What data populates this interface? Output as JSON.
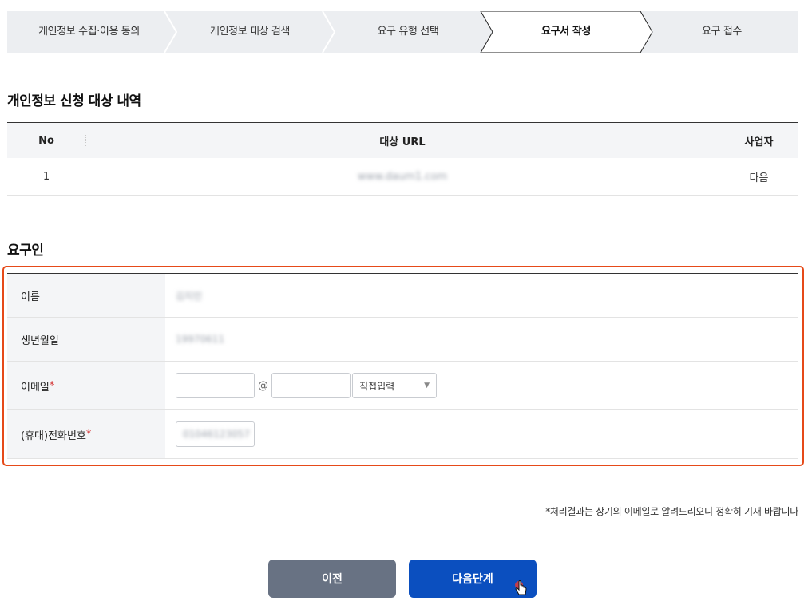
{
  "stepper": {
    "steps": [
      {
        "label": "개인정보 수집·이용 동의"
      },
      {
        "label": "개인정보 대상 검색"
      },
      {
        "label": "요구 유형 선택"
      },
      {
        "label": "요구서 작성"
      },
      {
        "label": "요구 접수"
      }
    ],
    "active_index": 3
  },
  "target_section": {
    "title": "개인정보 신청 대상 내역",
    "columns": [
      "No",
      "대상 URL",
      "사업자"
    ],
    "rows": [
      {
        "no": "1",
        "url": "www.daum1.com",
        "business": "다음"
      }
    ]
  },
  "requester_section": {
    "title": "요구인",
    "name": {
      "label": "이름",
      "value": "김지민"
    },
    "birth": {
      "label": "생년월일",
      "value": "19970611"
    },
    "email": {
      "label": "이메일",
      "required_mark": "*",
      "local_value": "",
      "at": "@",
      "domain_value": "",
      "domain_select": "직접입력"
    },
    "phone": {
      "label": "(휴대)전화번호",
      "required_mark": "*",
      "value": "01046123057"
    }
  },
  "notice": "*처리결과는 상기의 이메일로 알려드리오니 정확히 기재 바랍니다",
  "buttons": {
    "prev": "이전",
    "next": "다음단계"
  },
  "colors": {
    "primary": "#0b4fbf",
    "secondary": "#687283",
    "highlight": "#e64a19",
    "required": "#d32f2f"
  }
}
